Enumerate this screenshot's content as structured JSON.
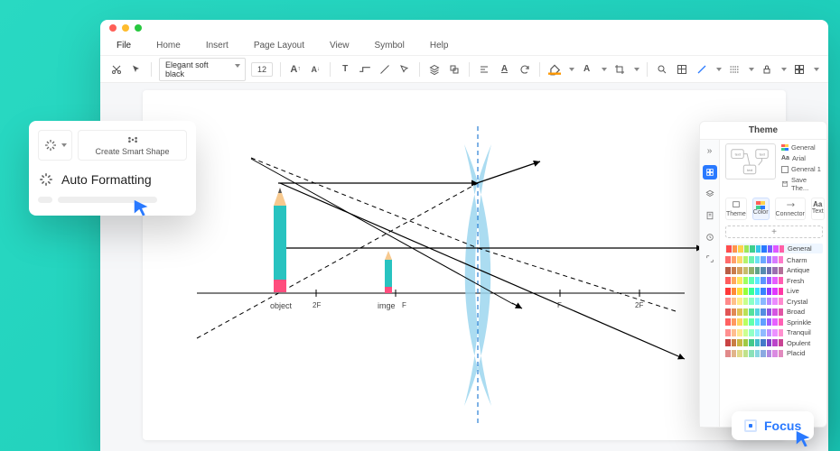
{
  "window": {
    "dots": [
      "#ff5f57",
      "#febc2e",
      "#28c840"
    ]
  },
  "menus": [
    "File",
    "Home",
    "Insert",
    "Page Layout",
    "View",
    "Symbol",
    "Help"
  ],
  "toolbar": {
    "font_name": "Elegant soft black",
    "font_size": "12",
    "paint_accent": "#ff9800",
    "stroke_color": "#2979ff"
  },
  "diagram": {
    "object_label": "object",
    "image_label": "imge",
    "f_label": "F",
    "two_f_label": "2F"
  },
  "popover": {
    "create_label": "Create Smart Shape",
    "auto_format_label": "Auto Formatting"
  },
  "theme_panel": {
    "title": "Theme",
    "options": [
      "General",
      "Arial",
      "General 1",
      "Save The..."
    ],
    "modes": [
      "Theme",
      "Color",
      "Connector",
      "Text"
    ],
    "palettes": [
      {
        "name": "General",
        "colors": [
          "#ff4d4d",
          "#ff944d",
          "#ffd24d",
          "#9be85a",
          "#3ecf8e",
          "#37c6ea",
          "#2979ff",
          "#7a5cff",
          "#e057ff",
          "#ff5fa6"
        ]
      },
      {
        "name": "Charm",
        "colors": [
          "#ff6b6b",
          "#ff9f6b",
          "#ffd66b",
          "#b6f26b",
          "#6bf2b0",
          "#6be2f2",
          "#6ba8ff",
          "#9a7aff",
          "#d77aff",
          "#ff7ac9"
        ]
      },
      {
        "name": "Antique",
        "colors": [
          "#b85c44",
          "#c97b4b",
          "#d6a15e",
          "#c7bd6a",
          "#8fb16b",
          "#5fa38a",
          "#568bb0",
          "#6e6fb0",
          "#9b6fb0",
          "#b36f98"
        ]
      },
      {
        "name": "Fresh",
        "colors": [
          "#ff5d5d",
          "#ffa85d",
          "#ffe75d",
          "#9fff5d",
          "#5dffb5",
          "#5de8ff",
          "#5d95ff",
          "#9c5dff",
          "#e65dff",
          "#ff5db1"
        ]
      },
      {
        "name": "Live",
        "colors": [
          "#ff3838",
          "#ff8a38",
          "#ffdc38",
          "#96ff38",
          "#38ff9a",
          "#38e0ff",
          "#3882ff",
          "#8e38ff",
          "#e038ff",
          "#ff38a5"
        ]
      },
      {
        "name": "Crystal",
        "colors": [
          "#ff8a8a",
          "#ffc08a",
          "#ffed8a",
          "#c8ff8a",
          "#8affc7",
          "#8aedff",
          "#8ab8ff",
          "#b98aff",
          "#ec8aff",
          "#ff8acf"
        ]
      },
      {
        "name": "Broad",
        "colors": [
          "#e15555",
          "#e18955",
          "#e1c055",
          "#b9e155",
          "#55e19d",
          "#55d1e1",
          "#558de1",
          "#8f55e1",
          "#d555e1",
          "#e155a5"
        ]
      },
      {
        "name": "Sprinkle",
        "colors": [
          "#ff6161",
          "#ff9961",
          "#ffd561",
          "#b9ff61",
          "#61ffad",
          "#61e6ff",
          "#619fff",
          "#9d61ff",
          "#e661ff",
          "#ff61b5"
        ]
      },
      {
        "name": "Tranquil",
        "colors": [
          "#ff9090",
          "#ffbe90",
          "#ffe790",
          "#cbff90",
          "#90ffc7",
          "#90ecff",
          "#90baff",
          "#bb90ff",
          "#ec90ff",
          "#ff90cf"
        ]
      },
      {
        "name": "Opulent",
        "colors": [
          "#c94444",
          "#c97e44",
          "#c9b744",
          "#9fc944",
          "#44c98b",
          "#44bbc9",
          "#447ac9",
          "#7e44c9",
          "#bb44c9",
          "#c94494"
        ]
      },
      {
        "name": "Placid",
        "colors": [
          "#e18a8a",
          "#e1b48a",
          "#e1da8a",
          "#c0e18a",
          "#8ae1b8",
          "#8ad6e1",
          "#8aa9e1",
          "#b08ae1",
          "#da8ae1",
          "#e18abe"
        ]
      }
    ]
  },
  "focus": {
    "label": "Focus"
  }
}
